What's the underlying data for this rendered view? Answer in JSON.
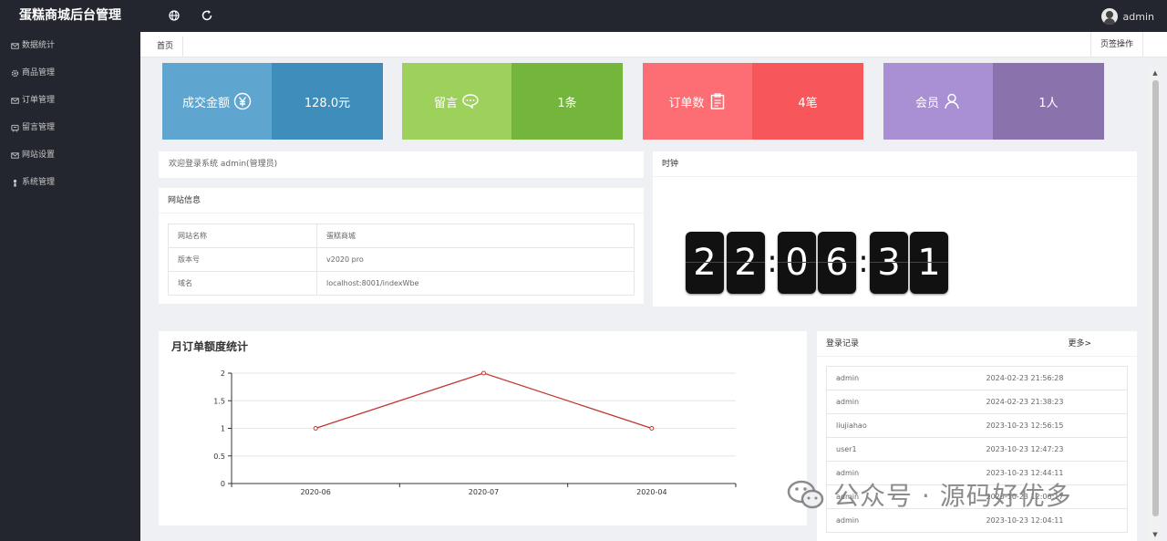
{
  "app": {
    "title": "蛋糕商城后台管理",
    "user": "admin"
  },
  "topbar": {
    "icons": [
      "globe-icon",
      "refresh-icon"
    ]
  },
  "sidebar": {
    "items": [
      {
        "label": "数据统计",
        "icon": "mail-icon"
      },
      {
        "label": "商品管理",
        "icon": "gear-icon"
      },
      {
        "label": "订单管理",
        "icon": "mail-icon"
      },
      {
        "label": "留言管理",
        "icon": "message-icon"
      },
      {
        "label": "网站设置",
        "icon": "mail-icon"
      },
      {
        "label": "系统管理",
        "icon": "person-icon"
      }
    ]
  },
  "tabs": {
    "home": "首页",
    "ops": "页签操作"
  },
  "stats": [
    {
      "label": "成交金额",
      "value": "128.0元",
      "icon": "yen-icon",
      "left_color": "#5ea6d0",
      "right_color": "#3f8dbb"
    },
    {
      "label": "留言",
      "value": "1条",
      "icon": "chat-icon",
      "left_color": "#9ed15c",
      "right_color": "#74b63c"
    },
    {
      "label": "订单数",
      "value": "4笔",
      "icon": "clipboard-icon",
      "left_color": "#fc6e73",
      "right_color": "#f7565b"
    },
    {
      "label": "会员",
      "value": "1人",
      "icon": "user-icon",
      "left_color": "#a98fd4",
      "right_color": "#8a73ad"
    }
  ],
  "welcome": "欢迎登录系统 admin(管理员)",
  "site_info": {
    "title": "网站信息",
    "rows": [
      {
        "key": "网站名称",
        "value": "蛋糕商城"
      },
      {
        "key": "版本号",
        "value": "v2020 pro"
      },
      {
        "key": "域名",
        "value": "localhost:8001/indexWbe"
      }
    ]
  },
  "clock": {
    "title": "时钟",
    "digits": [
      "2",
      "2",
      "0",
      "6",
      "3",
      "1"
    ],
    "separator": ":"
  },
  "chart_data": {
    "type": "line",
    "title": "月订单额度统计",
    "categories": [
      "2020-06",
      "2020-07",
      "2020-04"
    ],
    "series": [
      {
        "values": [
          1,
          2,
          1
        ],
        "color": "#c23531"
      }
    ],
    "ylim": [
      0,
      2
    ],
    "yticks": [
      "0",
      "0.5",
      "1",
      "1.5",
      "2"
    ],
    "grid": true
  },
  "login_log": {
    "title": "登录记录",
    "more": "更多>",
    "rows": [
      {
        "user": "admin",
        "time": "2024-02-23 21:56:28"
      },
      {
        "user": "admin",
        "time": "2024-02-23 21:38:23"
      },
      {
        "user": "liujiahao",
        "time": "2023-10-23 12:56:15"
      },
      {
        "user": "user1",
        "time": "2023-10-23 12:47:23"
      },
      {
        "user": "admin",
        "time": "2023-10-23 12:44:11"
      },
      {
        "user": "admin",
        "time": "2023-10-23 12:06:17"
      },
      {
        "user": "admin",
        "time": "2023-10-23 12:04:11"
      }
    ]
  },
  "watermark": "公众号 · 源码好优多"
}
